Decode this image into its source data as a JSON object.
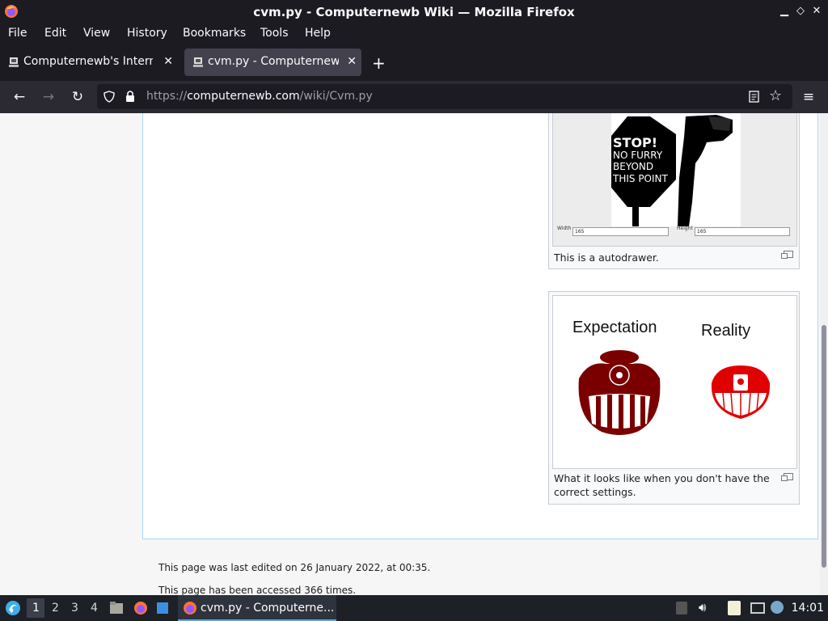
{
  "window": {
    "title": "cvm.py - Computernewb Wiki — Mozilla Firefox",
    "min": "▁",
    "max": "◇",
    "close": "✕"
  },
  "menu": [
    "File",
    "Edit",
    "View",
    "History",
    "Bookmarks",
    "Tools",
    "Help"
  ],
  "tabs": [
    {
      "label": "Computernewb's Internet",
      "active": false
    },
    {
      "label": "cvm.py - Computernewb",
      "active": true
    }
  ],
  "newtab": "+",
  "nav": {
    "url_prefix": "https://",
    "url_host": "computernewb.com",
    "url_path": "/wiki/Cvm.py"
  },
  "figures": [
    {
      "caption": "This is a autodrawer.",
      "sign_lines": [
        "STOP!",
        "NO FURRY",
        "BEYOND",
        "THIS POINT"
      ],
      "width_label": "Width",
      "width_value": "165",
      "height_label": "Height",
      "height_value": "165"
    },
    {
      "caption": "What it looks like when you don't have the correct settings.",
      "left_label": "Expectation",
      "right_label": "Reality"
    }
  ],
  "footer": {
    "last_edited": "This page was last edited on 26 January 2022, at 00:35.",
    "accessed": "This page has been accessed 366 times."
  },
  "taskbar": {
    "workspaces": [
      "1",
      "2",
      "3",
      "4"
    ],
    "task_label": "cvm.py - Computerne...",
    "clock": "14:01"
  },
  "colors": {
    "accent": "#3daee9",
    "chrome": "#1c1b22",
    "expectation": "#7a0000",
    "reality": "#e00000"
  }
}
